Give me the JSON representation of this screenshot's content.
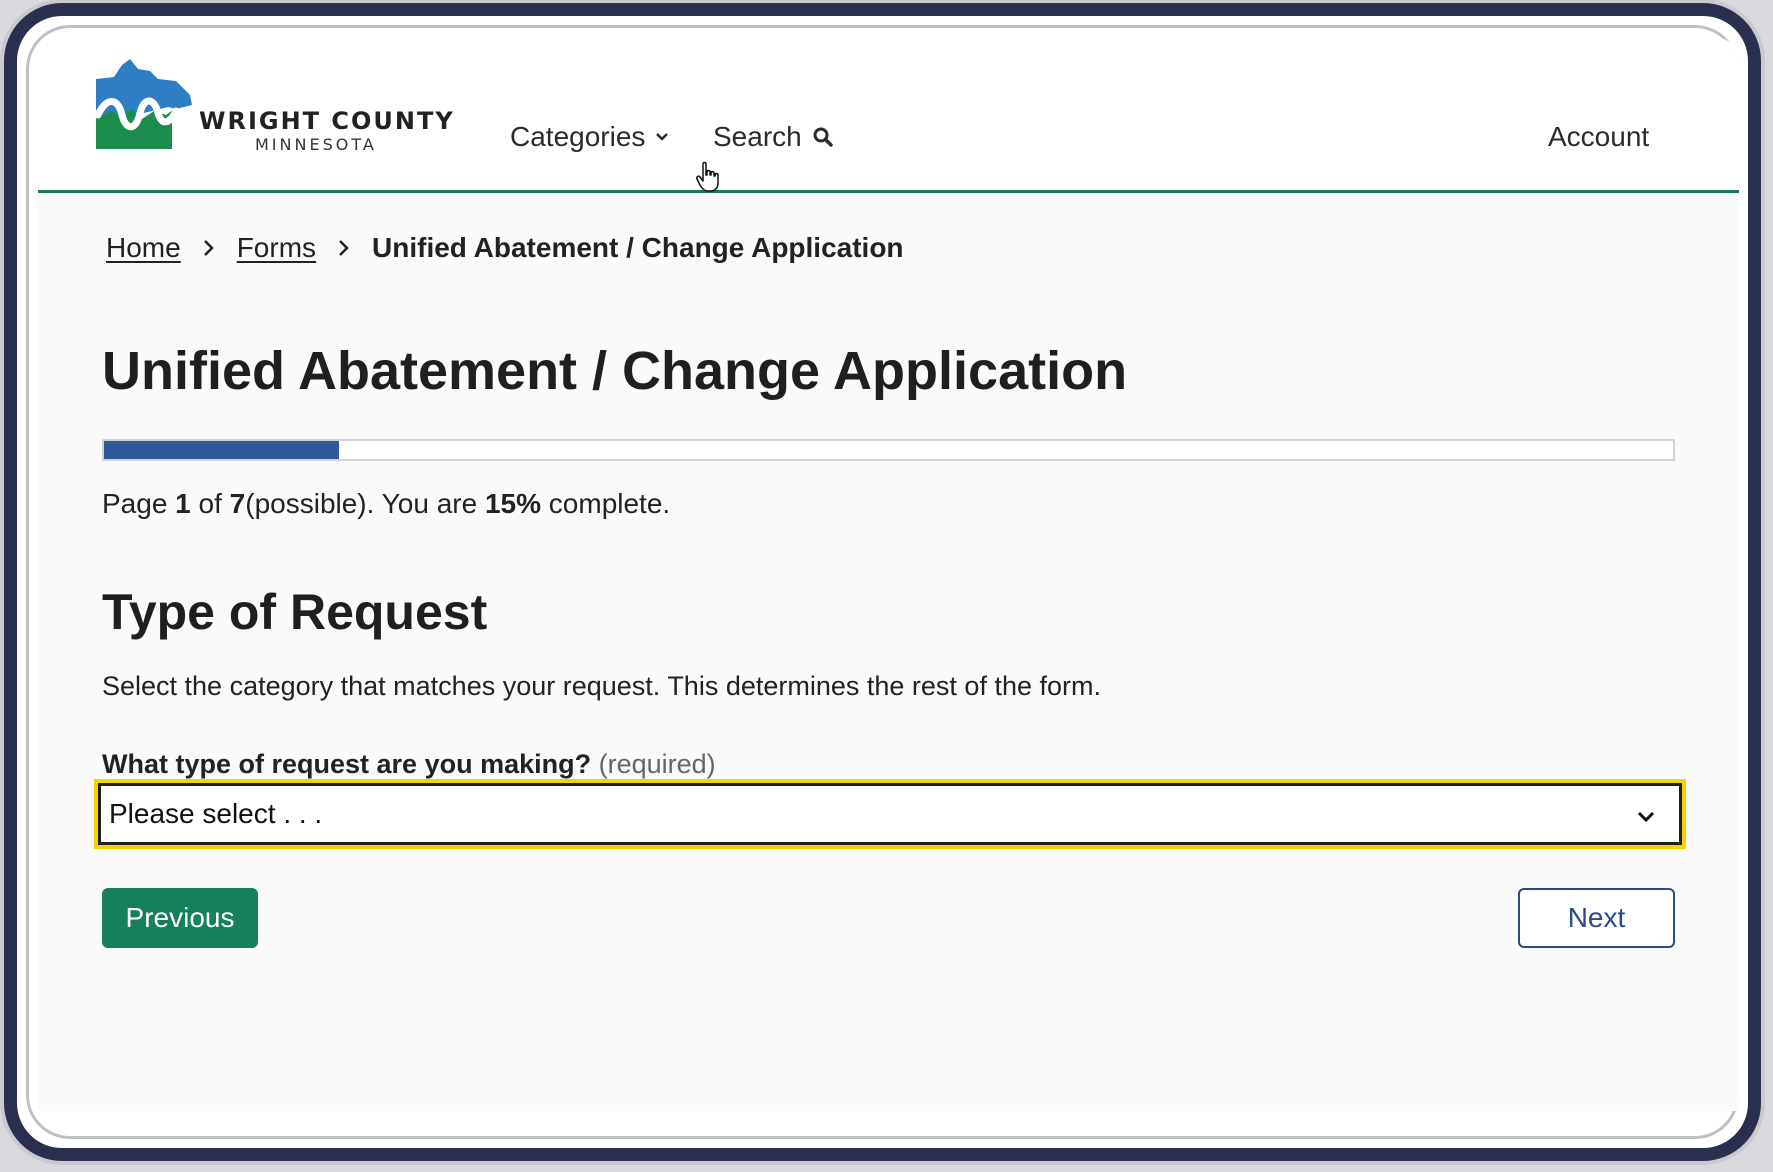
{
  "header": {
    "logo": {
      "name": "WRIGHT COUNTY",
      "state": "MINNESOTA"
    },
    "nav": {
      "categories": "Categories",
      "search": "Search",
      "account": "Account"
    }
  },
  "breadcrumb": {
    "home": "Home",
    "forms": "Forms",
    "current": "Unified Abatement / Change Application"
  },
  "main": {
    "title": "Unified Abatement / Change Application",
    "progress": {
      "percent": 15,
      "prefix": "Page ",
      "page": "1",
      "of": " of ",
      "total": "7",
      "suffix": "(possible). You are ",
      "percent_label": "15%",
      "end": " complete."
    },
    "section_title": "Type of Request",
    "instructions": "Select the category that matches your request. This determines the rest of the form.",
    "field": {
      "label": "What type of request are you making?",
      "required": "(required)",
      "selected": "Please select . . ."
    },
    "buttons": {
      "previous": "Previous",
      "next": "Next"
    }
  },
  "colors": {
    "accent_green": "#15805a",
    "progress_blue": "#2e5a9a",
    "focus_yellow": "#f2d300",
    "next_blue": "#2b4a86"
  },
  "icons": [
    "chevron-down-icon",
    "search-icon",
    "chevron-right-icon",
    "hand-cursor-icon"
  ]
}
